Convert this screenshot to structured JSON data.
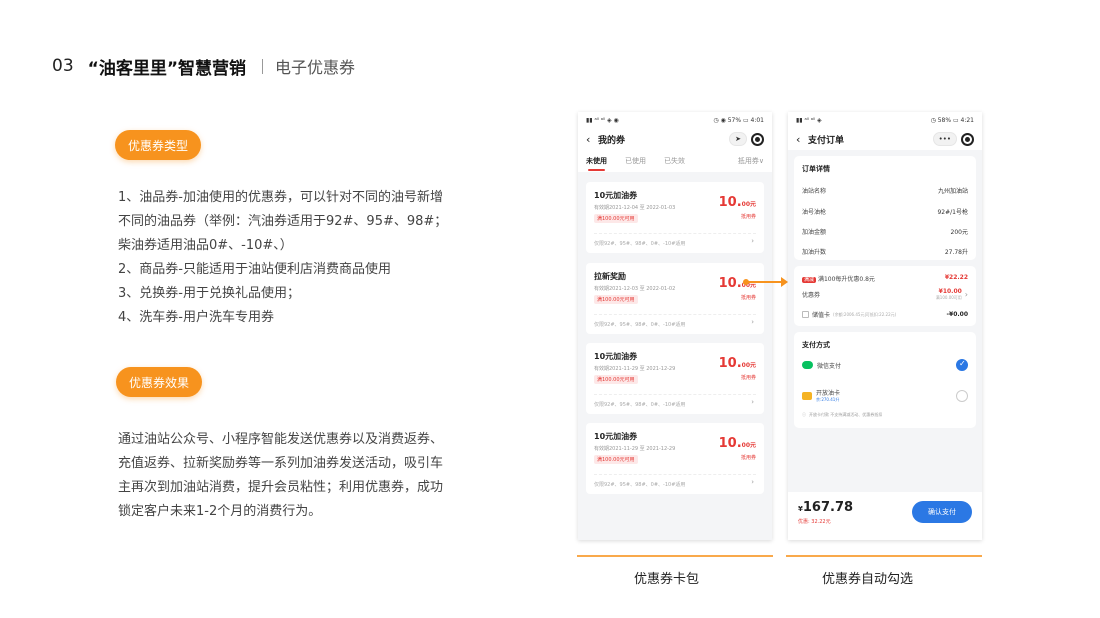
{
  "header": {
    "number": "03",
    "title": "“油客里里”智慧营销",
    "subtitle": "电子优惠券"
  },
  "left": {
    "types_pill": "优惠券类型",
    "types_lines": [
      "1、油品券-加油使用的优惠券，可以针对不同的油号新增",
      "不同的油品券（举例：汽油券适用于92#、95#、98#；",
      "柴油券适用油品0#、-10#、）",
      "2、商品券-只能适用于油站便利店消费商品使用",
      "3、兑换券-用于兑换礼品使用；",
      "4、洗车券-用户洗车专用券"
    ],
    "effect_pill": "优惠券效果",
    "effect_lines": [
      "通过油站公众号、小程序智能发送优惠券以及消费返券、",
      "充值返券、拉新奖励券等一系列加油券发送活动，吸引车",
      "主再次到加油站消费，提升会员粘性；利用优惠券，成功",
      "锁定客户未来1-2个月的消费行为。"
    ]
  },
  "phone_left": {
    "status_left": "▮▮ ᵃˡˡ ᵃˡˡ ◈ ◉",
    "status_right": "◷ ◉ 57% ▭ 4:01",
    "title": "我的券",
    "tabs": [
      "未使用",
      "已使用",
      "已失效",
      "抵用券∨"
    ],
    "coupons": [
      {
        "name": "10元加油券",
        "date": "有效期2021-12-04 至 2022-01-03",
        "tag": "满100.00元可用",
        "amount": "10.",
        "cents": "00元",
        "type": "抵用券",
        "foot": "仅限92#、95#、98#、0#、-10#适用"
      },
      {
        "name": "拉新奖励",
        "date": "有效期2021-12-03 至 2022-01-02",
        "tag": "满100.00元可用",
        "amount": "10.",
        "cents": "00元",
        "type": "抵用券",
        "foot": "仅限92#、95#、98#、0#、-10#适用"
      },
      {
        "name": "10元加油券",
        "date": "有效期2021-11-29 至 2021-12-29",
        "tag": "满100.00元可用",
        "amount": "10.",
        "cents": "00元",
        "type": "抵用券",
        "foot": "仅限92#、95#、98#、0#、-10#适用"
      },
      {
        "name": "10元加油券",
        "date": "有效期2021-11-29 至 2021-12-29",
        "tag": "满100.00元可用",
        "amount": "10.",
        "cents": "00元",
        "type": "抵用券",
        "foot": "仅限92#、95#、98#、0#、-10#适用"
      }
    ],
    "caption": "优惠券卡包"
  },
  "phone_right": {
    "status_left": "▮▮ ᵃˡˡ ᵃˡˡ ◈",
    "status_right": "◷ 58% ▭ 4:21",
    "title": "支付订单",
    "order": {
      "heading": "订单详情",
      "rows": [
        {
          "k": "油站名称",
          "v": "九州加油站"
        },
        {
          "k": "油号油枪",
          "v": "92#/1号枪"
        },
        {
          "k": "加油金额",
          "v": "200元"
        },
        {
          "k": "加油升数",
          "v": "27.78升"
        }
      ]
    },
    "discount": {
      "badge": "满减",
      "promo": "满100每升优惠0.8元",
      "promo_value": "¥22.22",
      "coupon_label": "优惠券",
      "coupon_value": "¥10.00",
      "coupon_note": "满100.00可用",
      "card_label": "储值卡",
      "card_note": "(余额:2006.45元|可抵扣:22.22元)",
      "card_value": "-¥0.00"
    },
    "payment": {
      "heading": "支付方式",
      "wechat": "微信支付",
      "card_name": "开放油卡",
      "card_balance": "余:270.41升",
      "card_tip": "开放卡付款 不支持满减活动、优惠券抵扣"
    },
    "total": "167.78",
    "currency": "¥",
    "saved": "优惠: 32.22元",
    "confirm": "确认支付",
    "caption": "优惠券自动勾选"
  },
  "colors": {
    "accent": "#f7931e",
    "price_red": "#e53935",
    "pay_blue": "#2b78e4"
  }
}
